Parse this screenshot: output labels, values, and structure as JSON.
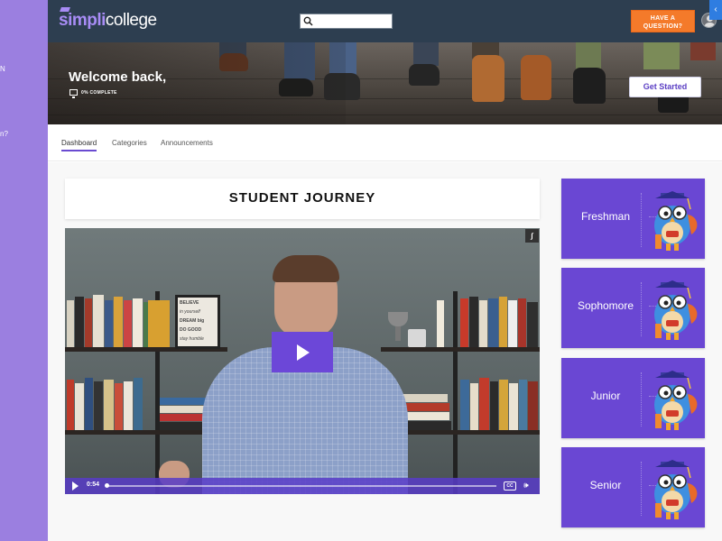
{
  "sidebar": {
    "fragments": [
      "N",
      "n?"
    ]
  },
  "header": {
    "logo_simpli": "simpli",
    "logo_college": "college",
    "search_placeholder": "",
    "ask_button": "HAVE A QUESTION?",
    "toggle_icon": "chevron-left-icon"
  },
  "hero": {
    "welcome": "Welcome back,",
    "progress_text": "0% COMPLETE",
    "progress_percent": 0,
    "cta": "Get Started"
  },
  "tabs": [
    {
      "label": "Dashboard",
      "active": true
    },
    {
      "label": "Categories",
      "active": false
    },
    {
      "label": "Announcements",
      "active": false
    }
  ],
  "journey": {
    "title": "STUDENT JOURNEY"
  },
  "video": {
    "time": "0:54",
    "captions_label": "CC",
    "frame_text": [
      "BELIEVE",
      "in yourself",
      "DREAM big",
      "DO GOOD",
      "stay humble"
    ]
  },
  "years": [
    {
      "label": "Freshman"
    },
    {
      "label": "Sophomore"
    },
    {
      "label": "Junior"
    },
    {
      "label": "Senior"
    }
  ],
  "colors": {
    "sidebar": "#9b7fe0",
    "topbar": "#2d3e50",
    "accent_orange": "#f47a2a",
    "brand_purple": "#6a47d3"
  }
}
